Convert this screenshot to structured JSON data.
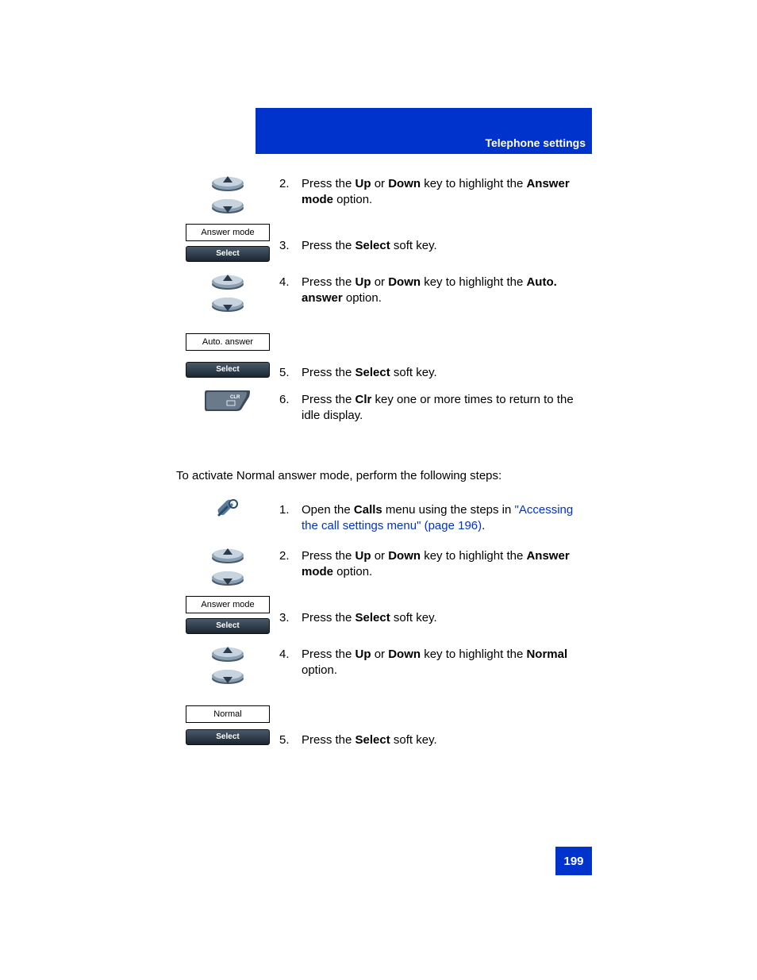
{
  "header": {
    "title": "Telephone settings"
  },
  "page_number": "199",
  "sectionA": {
    "step2": {
      "num": "2.",
      "t1": "Press the ",
      "up": "Up",
      "t2": " or ",
      "down": "Down",
      "t3": " key to highlight the ",
      "opt": "Answer mode",
      "t4": " option."
    },
    "step3": {
      "num": "3.",
      "label_box": "Answer mode",
      "select_btn": "Select",
      "t1": "Press the ",
      "b1": "Select",
      "t2": " soft key."
    },
    "step4": {
      "num": "4.",
      "label_box": "Auto. answer",
      "t1": "Press the ",
      "up": "Up",
      "t2": " or ",
      "down": "Down",
      "t3": " key to highlight the ",
      "opt": "Auto. answer",
      "t4": " option."
    },
    "step5": {
      "num": "5.",
      "select_btn": "Select",
      "t1": "Press the ",
      "b1": "Select",
      "t2": " soft key."
    },
    "step6": {
      "num": "6.",
      "t1": "Press the ",
      "b1": "Clr",
      "t2": " key one or more times to return to the idle display."
    }
  },
  "intro": "To activate Normal answer mode, perform the following steps:",
  "sectionB": {
    "step1": {
      "num": "1.",
      "t1": "Open the ",
      "b1": "Calls",
      "t2": " menu using the steps in ",
      "link": "\"Accessing the call settings menu\" (page 196)",
      "t3": "."
    },
    "step2": {
      "num": "2.",
      "t1": "Press the ",
      "up": "Up",
      "t2": " or ",
      "down": "Down",
      "t3": " key to highlight the ",
      "opt": "Answer mode",
      "t4": " option."
    },
    "step3": {
      "num": "3.",
      "label_box": "Answer mode",
      "select_btn": "Select",
      "t1": "Press the ",
      "b1": "Select",
      "t2": " soft key."
    },
    "step4": {
      "num": "4.",
      "label_box": "Normal",
      "t1": "Press the ",
      "up": "Up",
      "t2": " or ",
      "down": "Down",
      "t3": " key to highlight the ",
      "opt": "Normal",
      "t4": " option."
    },
    "step5": {
      "num": "5.",
      "select_btn": "Select",
      "t1": "Press the ",
      "b1": "Select",
      "t2": " soft key."
    }
  }
}
